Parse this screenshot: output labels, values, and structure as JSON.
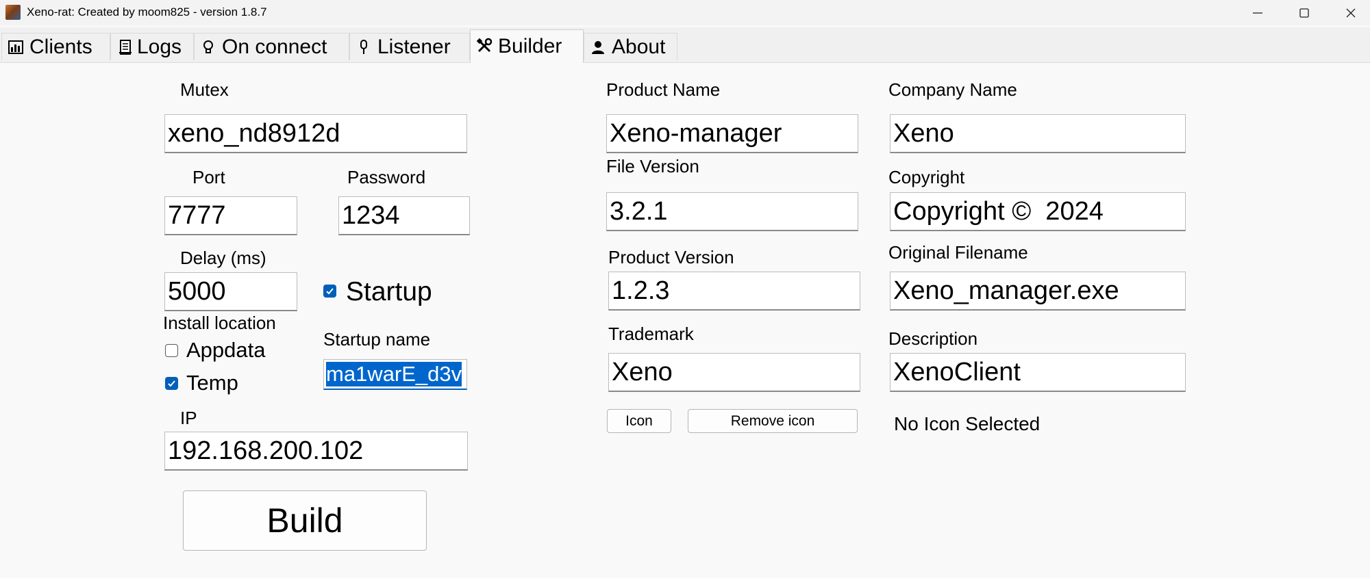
{
  "window": {
    "title": "Xeno-rat: Created by moom825 - version 1.8.7"
  },
  "tabs": [
    {
      "label": "Clients",
      "icon": "bar-chart-icon"
    },
    {
      "label": "Logs",
      "icon": "log-icon"
    },
    {
      "label": "On connect",
      "icon": "lightbulb-icon"
    },
    {
      "label": "Listener",
      "icon": "microphone-icon"
    },
    {
      "label": "Builder",
      "icon": "tools-icon",
      "active": true
    },
    {
      "label": "About",
      "icon": "person-icon"
    }
  ],
  "builder": {
    "mutex": {
      "label": "Mutex",
      "value": "xeno_nd8912d"
    },
    "port": {
      "label": "Port",
      "value": "7777"
    },
    "password": {
      "label": "Password",
      "value": "1234"
    },
    "delay": {
      "label": "Delay (ms)",
      "value": "5000"
    },
    "startup": {
      "label": "Startup",
      "checked": true
    },
    "install_location": {
      "label": "Install location",
      "appdata": {
        "label": "Appdata",
        "checked": false
      },
      "temp": {
        "label": "Temp",
        "checked": true
      }
    },
    "startup_name": {
      "label": "Startup name",
      "value": "ma1warE_d3v"
    },
    "ip": {
      "label": "IP",
      "value": "192.168.200.102"
    },
    "build_button": "Build",
    "product_name": {
      "label": "Product Name",
      "value": "Xeno-manager"
    },
    "file_version": {
      "label": "File Version",
      "value": "3.2.1"
    },
    "product_version": {
      "label": "Product Version",
      "value": "1.2.3"
    },
    "trademark": {
      "label": "Trademark",
      "value": "Xeno"
    },
    "icon_button": "Icon",
    "remove_icon_button": "Remove icon",
    "company_name": {
      "label": "Company Name",
      "value": "Xeno"
    },
    "copyright": {
      "label": "Copyright",
      "value": "Copyright ©  2024"
    },
    "original_filename": {
      "label": "Original Filename",
      "value": "Xeno_manager.exe"
    },
    "description": {
      "label": "Description",
      "value": "XenoClient"
    },
    "icon_status": "No Icon Selected"
  },
  "colors": {
    "accent": "#005fb8",
    "selection": "#0066cc",
    "window_bg": "#f9f9f9"
  }
}
